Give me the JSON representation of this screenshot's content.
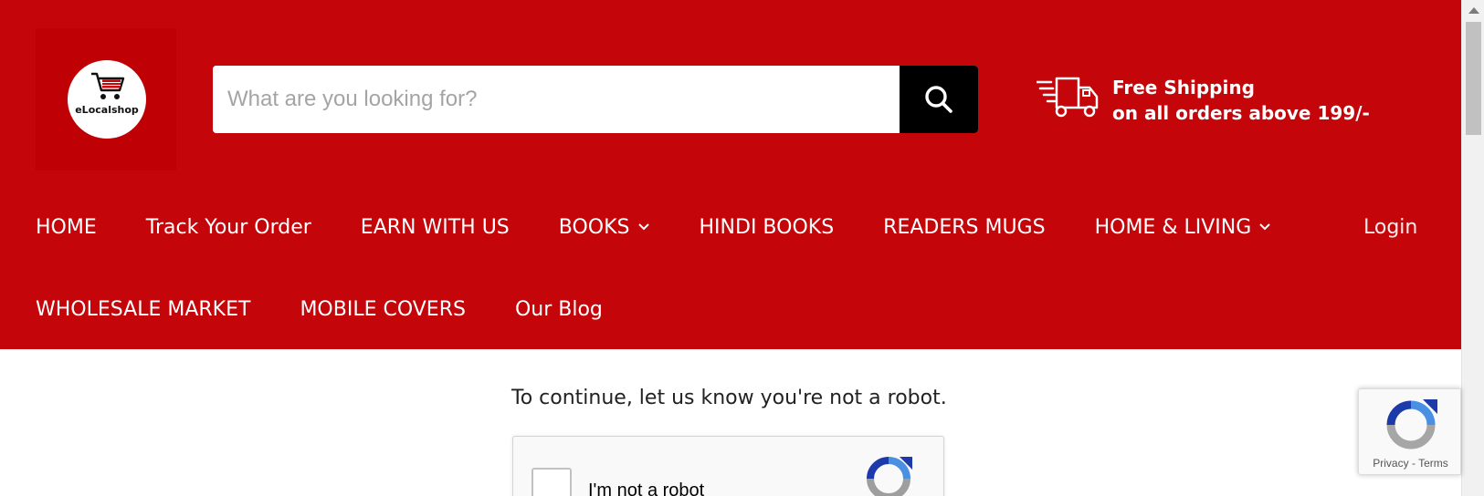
{
  "brand": {
    "logo_text": "eLocalshop",
    "primary_color": "#c4060b"
  },
  "search": {
    "placeholder": "What are you looking for?",
    "value": ""
  },
  "shipping": {
    "line1": "Free Shipping",
    "line2": "on all orders above 199/-"
  },
  "nav": {
    "row1": [
      {
        "label": "HOME",
        "dropdown": false
      },
      {
        "label": "Track Your Order",
        "dropdown": false
      },
      {
        "label": "EARN WITH US",
        "dropdown": false
      },
      {
        "label": "BOOKS",
        "dropdown": true
      },
      {
        "label": "HINDI BOOKS",
        "dropdown": false
      },
      {
        "label": "READERS MUGS",
        "dropdown": false
      },
      {
        "label": "HOME & LIVING",
        "dropdown": true
      }
    ],
    "row2": [
      {
        "label": "WHOLESALE MARKET",
        "dropdown": false
      },
      {
        "label": "MOBILE COVERS",
        "dropdown": false
      },
      {
        "label": "Our Blog",
        "dropdown": false
      }
    ],
    "login_label": "Login"
  },
  "main": {
    "notice": "To continue, let us know you're not a robot.",
    "captcha_label": "I'm not a robot"
  },
  "recaptcha_badge": {
    "privacy": "Privacy",
    "separator": " - ",
    "terms": "Terms"
  }
}
